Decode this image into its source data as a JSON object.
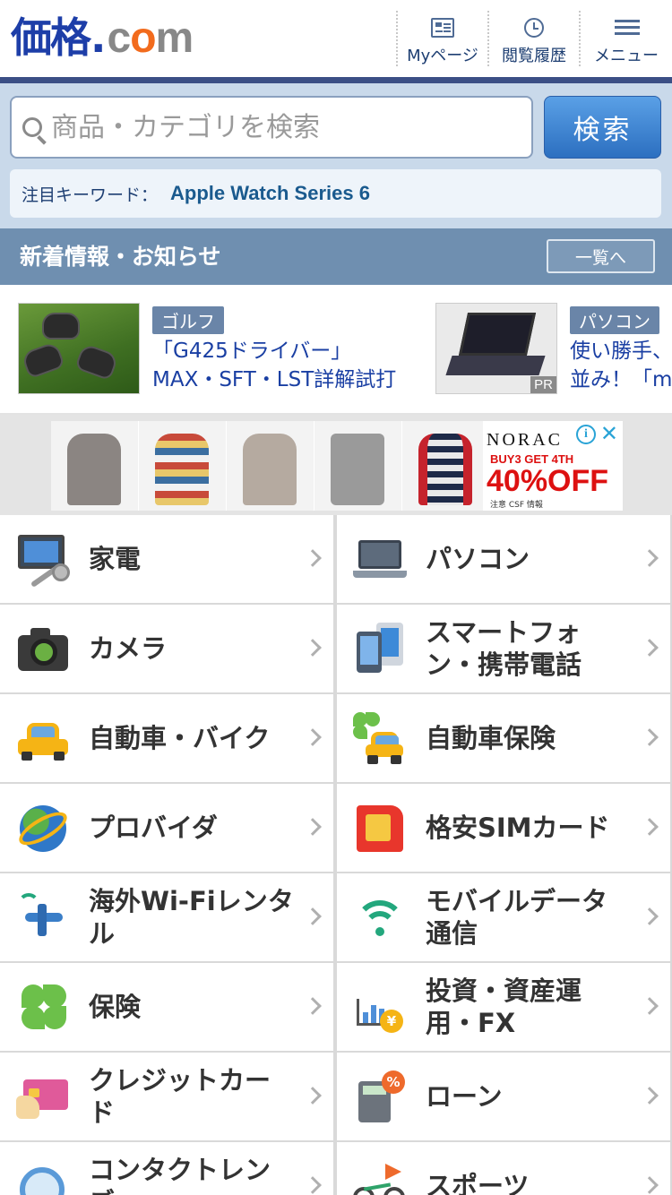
{
  "header": {
    "logo_kanji": "価格",
    "logo_dot": ".",
    "logo_c": "c",
    "logo_o": "o",
    "logo_m": "m",
    "nav": [
      {
        "label": "Myページ",
        "icon": "mypage-icon"
      },
      {
        "label": "閲覧履歴",
        "icon": "clock-icon"
      },
      {
        "label": "メニュー",
        "icon": "hamburger-menu-icon"
      }
    ]
  },
  "search": {
    "placeholder": "商品・カテゴリを検索",
    "value": "",
    "button_label": "検索",
    "keyword_label": "注目キーワード：",
    "keyword_value": "Apple Watch Series 6"
  },
  "news": {
    "title": "新着情報・お知らせ",
    "more_label": "一覧へ",
    "items": [
      {
        "tag": "ゴルフ",
        "text": "「G425ドライバー」MAX・SFT・LST詳解試打",
        "pr": ""
      },
      {
        "tag": "パソコン",
        "text": "使い勝手、並み！「m",
        "pr": "PR"
      }
    ]
  },
  "ad": {
    "brand": "NORAC",
    "sub": "BUY3 GET 4TH",
    "offer": "40%OFF",
    "fine": "注意 CSF 情報",
    "info": "i",
    "close": "✕"
  },
  "categories": [
    {
      "label": "家電",
      "icon": "tv-appliance-icon"
    },
    {
      "label": "パソコン",
      "icon": "laptop-icon"
    },
    {
      "label": "カメラ",
      "icon": "camera-icon"
    },
    {
      "label": "スマートフォン・携帯電話",
      "icon": "smartphone-icon"
    },
    {
      "label": "自動車・バイク",
      "icon": "car-icon"
    },
    {
      "label": "自動車保険",
      "icon": "car-insurance-icon"
    },
    {
      "label": "プロバイダ",
      "icon": "globe-icon"
    },
    {
      "label": "格安SIMカード",
      "icon": "sim-card-icon"
    },
    {
      "label": "海外Wi-Fiレンタル",
      "icon": "wifi-plane-icon"
    },
    {
      "label": "モバイルデータ通信",
      "icon": "wifi-icon"
    },
    {
      "label": "保険",
      "icon": "clover-icon"
    },
    {
      "label": "投資・資産運用・FX",
      "icon": "investment-chart-icon"
    },
    {
      "label": "クレジットカード",
      "icon": "credit-card-icon"
    },
    {
      "label": "ローン",
      "icon": "calculator-icon"
    },
    {
      "label": "コンタクトレンズ",
      "icon": "contact-lens-icon"
    },
    {
      "label": "スポーツ",
      "icon": "bicycle-icon"
    }
  ],
  "colors": {
    "brand_blue": "#1d3ea8",
    "brand_orange": "#f26b1d",
    "header_bar": "#3b4f85",
    "search_bg": "#c9d9ea",
    "news_header": "#6f8fb0",
    "search_button": "#2c6fc0"
  }
}
